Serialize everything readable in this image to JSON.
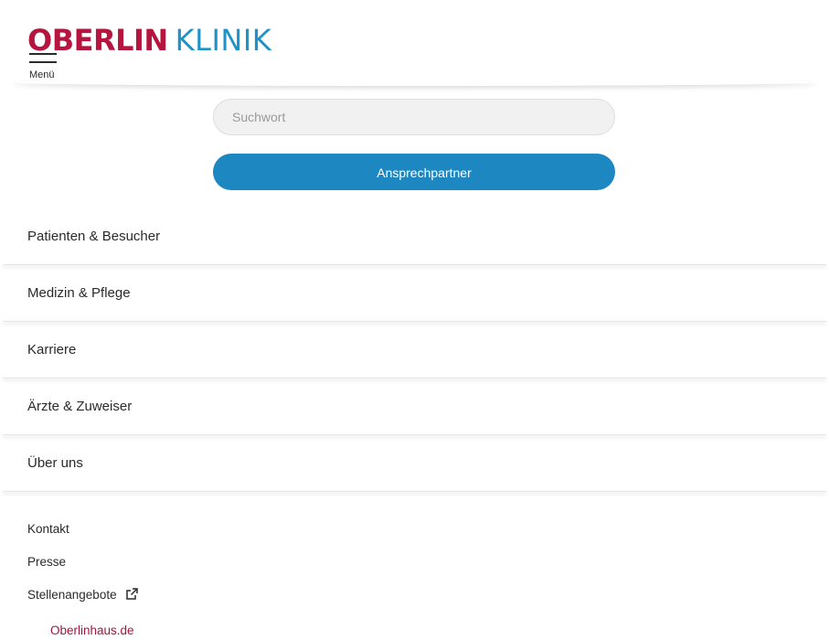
{
  "header": {
    "logo": {
      "part_1": "OBERLIN",
      "part_2": "KLINIK"
    },
    "menu_label": "Menü",
    "menu_icon": "hamburger-icon"
  },
  "search": {
    "placeholder": "Suchwort",
    "value": ""
  },
  "contact_button": {
    "label": "Ansprechpartner"
  },
  "main_nav": {
    "items": [
      {
        "label": "Patienten & Besucher"
      },
      {
        "label": "Medizin & Pflege"
      },
      {
        "label": "Karriere"
      },
      {
        "label": "Ärzte & Zuweiser"
      },
      {
        "label": "Über uns"
      }
    ]
  },
  "footer": {
    "links": {
      "kontakt": "Kontakt",
      "presse": "Presse",
      "stellenangebote": "Stellenangebote"
    },
    "external_icon": "external-link-icon",
    "oberlinhaus": "Oberlinhaus.de"
  },
  "colors": {
    "brand_red": "#b5153f",
    "brand_blue": "#1d93c7",
    "button_blue": "#1d87c2",
    "link_red": "#a3163b"
  }
}
